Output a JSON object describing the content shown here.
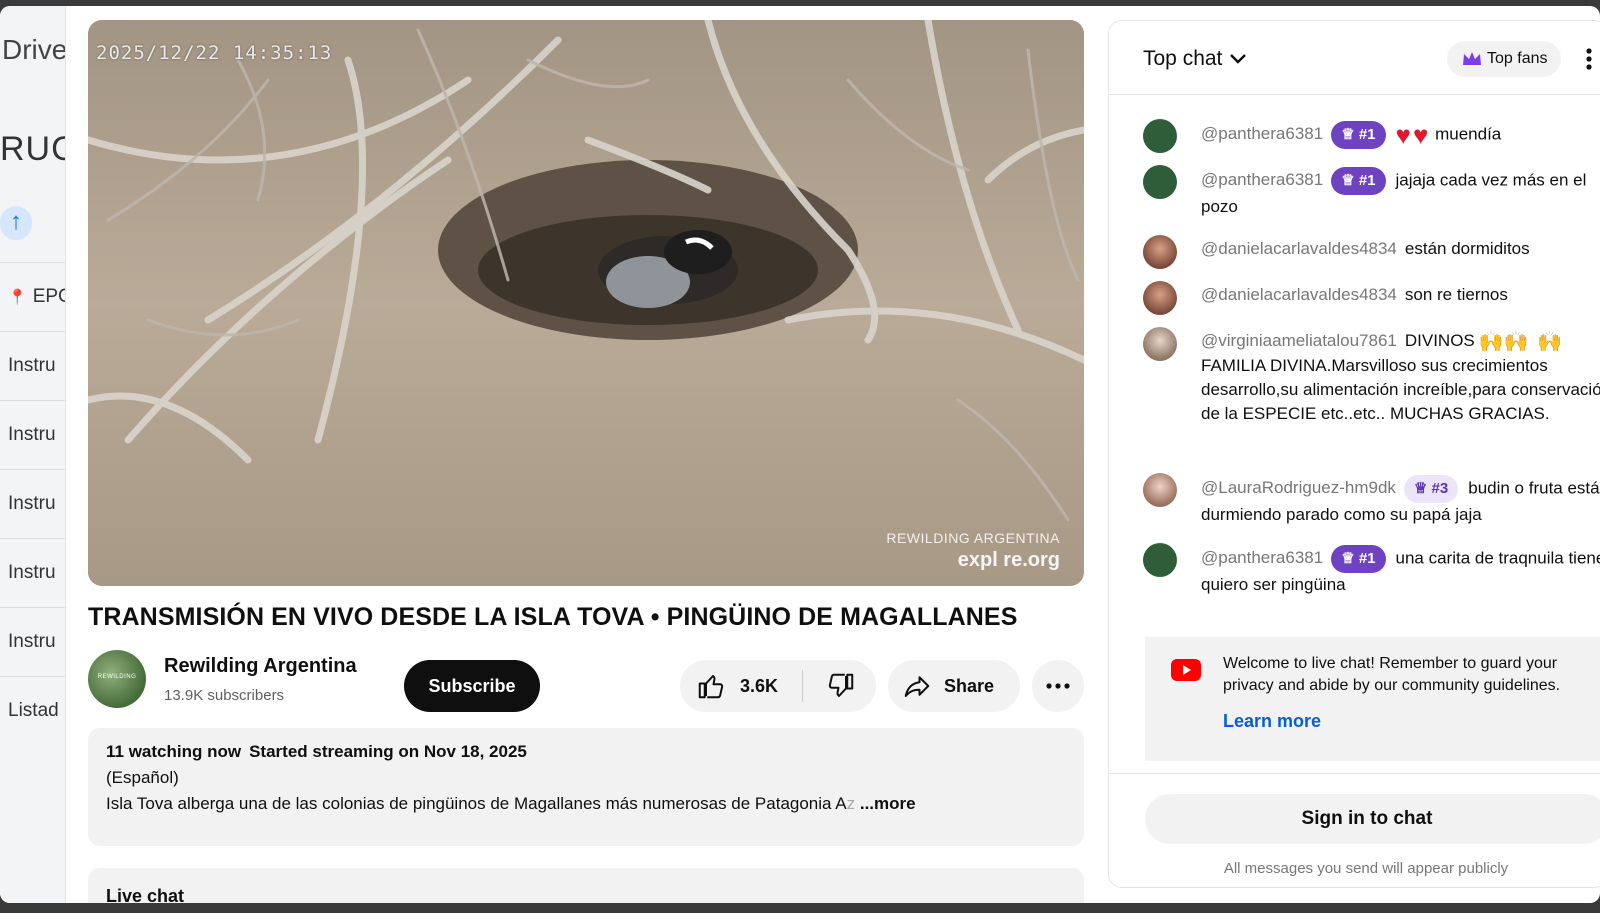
{
  "drive": {
    "title": "Drive",
    "heading": "RUCT",
    "items": [
      "EPC",
      "Instru",
      "Instru",
      "Instru",
      "Instru",
      "Instru",
      "Listad"
    ]
  },
  "video": {
    "timestamp": "2025/12/22 14:35:13",
    "watermark_line1": "REWILDING ARGENTINA",
    "watermark_line2": "expl re.org",
    "title": "TRANSMISIÓN EN VIVO DESDE LA ISLA TOVA • PINGÜINO DE MAGALLANES"
  },
  "channel": {
    "avatar_text": "REWILDING",
    "name": "Rewilding Argentina",
    "subscribers": "13.9K subscribers",
    "subscribe_label": "Subscribe"
  },
  "actions": {
    "like_count": "3.6K",
    "share_label": "Share"
  },
  "description": {
    "watching": "11 watching now",
    "started": "Started streaming on Nov 18, 2025",
    "language": "(Español)",
    "text": "Isla Tova alberga una de las colonias de pingüinos de Magallanes más numerosas de Patagonia A",
    "text_fade": "z",
    "more_label": " ...more"
  },
  "live_chat_label": "Live chat",
  "chat": {
    "header_label": "Top chat",
    "top_fans_label": "Top fans",
    "messages": [
      {
        "author": "@panthera6381",
        "badge": "#1",
        "text": "muendía",
        "hearts": 2
      },
      {
        "author": "@panthera6381",
        "badge": "#1",
        "text": "jajaja cada vez más en el pozo"
      },
      {
        "author": "@danielacarlavaldes4834",
        "text": "están dormiditos"
      },
      {
        "author": "@danielacarlavaldes4834",
        "text": "son re tiernos"
      },
      {
        "author": "@virginiaameliatalou7861",
        "text_before": "DIVINOS",
        "text": "FAMILIA DIVINA.Marsvilloso sus crecimientos desarrollo,su alimentación increíble,para conservación de la ESPECIE etc..etc.. MUCHAS GRACIAS."
      },
      {
        "author": "@LauraRodriguez-hm9dk",
        "badge": "#3",
        "text": "budin o fruta está durmiendo parado como su papá jaja"
      },
      {
        "author": "@panthera6381",
        "badge": "#1",
        "text": "una carita de traqnuila tiene, quiero ser pingüina"
      }
    ],
    "welcome_text": "Welcome to live chat! Remember to guard your privacy and abide by our community guidelines.",
    "learn_more_label": "Learn more",
    "sign_in_label": "Sign in to chat",
    "public_note": "All messages you send will appear publicly"
  },
  "colors": {
    "badge_purple": "#6f42c1",
    "link_blue": "#065fd4",
    "youtube_red": "#ff0000"
  }
}
